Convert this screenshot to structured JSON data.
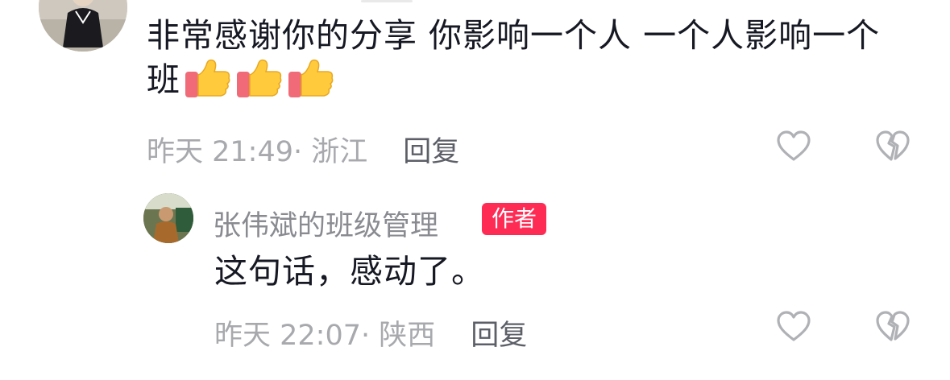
{
  "comment": {
    "text": "非常感谢你的分享 你影响一个人 一个人影响一个班",
    "emoji": [
      "thumbs-up",
      "thumbs-up",
      "thumbs-up"
    ],
    "time": "昨天 21:49",
    "location": "· 浙江",
    "reply_label": "回复",
    "like_icon": "heart-outline-icon",
    "dislike_icon": "broken-heart-outline-icon"
  },
  "reply": {
    "author": "张伟斌的班级管理",
    "badge": "作者",
    "text": "这句话，感动了。",
    "time": "昨天 22:07",
    "location": "· 陕西",
    "reply_label": "回复"
  },
  "colors": {
    "text": "#161823",
    "meta": "#a8a9ad",
    "reply": "#5d5f68",
    "author_name": "#8a8b91",
    "badge_bg": "#fe2c55",
    "icon_outline": "#b0b1b5"
  }
}
